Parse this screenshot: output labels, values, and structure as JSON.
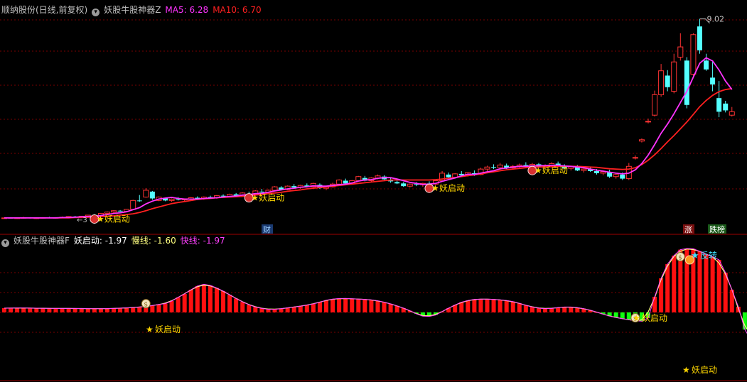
{
  "main_panel": {
    "title": "顺纳股份(日线,前复权)",
    "indicator_name": "妖股牛股神器Z",
    "ma5_label": "MA5: 6.28",
    "ma10_label": "MA10: 6.70",
    "high_label": "9.02",
    "signal_label": "妖启动",
    "cai_badge": "财",
    "zhang_badge": "涨",
    "diebang_badge": "跌榜",
    "colors": {
      "up": "#ff3333",
      "down": "#54ffff",
      "ma5": "#ff33ff",
      "ma10": "#ff2020",
      "title": "#c0c0c0",
      "grid": "#7a0000"
    }
  },
  "sub_panel": {
    "indicator_name": "妖股牛股神器F",
    "qidong_label": "妖启动: -1.97",
    "slow_label": "慢线: -1.60",
    "fast_label": "快线: -1.97",
    "signal_label": "妖启动",
    "reversal_label": "反转",
    "colors": {
      "pos": "#ff1010",
      "neg": "#10ff10",
      "slow": "#ffff80",
      "fast": "#ff40ff"
    }
  },
  "chart_data": [
    {
      "type": "candlestick",
      "title": "顺纳股份(日线,前复权)",
      "series": [
        {
          "name": "MA5",
          "color": "#ff33ff"
        },
        {
          "name": "MA10",
          "color": "#ff2020"
        }
      ],
      "max_price_label": 9.02,
      "ohlc": [
        [
          3.18,
          3.2,
          3.16,
          3.19
        ],
        [
          3.19,
          3.21,
          3.17,
          3.18
        ],
        [
          3.18,
          3.2,
          3.16,
          3.19
        ],
        [
          3.19,
          3.22,
          3.17,
          3.2
        ],
        [
          3.2,
          3.21,
          3.17,
          3.18
        ],
        [
          3.18,
          3.2,
          3.16,
          3.19
        ],
        [
          3.19,
          3.21,
          3.17,
          3.2
        ],
        [
          3.2,
          3.22,
          3.18,
          3.19
        ],
        [
          3.19,
          3.21,
          3.17,
          3.2
        ],
        [
          3.2,
          3.23,
          3.18,
          3.21
        ],
        [
          3.21,
          3.24,
          3.19,
          3.23
        ],
        [
          3.23,
          3.25,
          3.2,
          3.22
        ],
        [
          3.22,
          3.24,
          3.19,
          3.24
        ],
        [
          3.24,
          3.28,
          3.21,
          3.27
        ],
        [
          3.27,
          3.3,
          3.24,
          3.26
        ],
        [
          3.26,
          3.33,
          3.24,
          3.32
        ],
        [
          3.32,
          3.38,
          3.3,
          3.36
        ],
        [
          3.36,
          3.42,
          3.33,
          3.4
        ],
        [
          3.4,
          3.42,
          3.37,
          3.38
        ],
        [
          3.38,
          3.45,
          3.36,
          3.44
        ],
        [
          3.44,
          3.72,
          3.43,
          3.7
        ],
        [
          3.7,
          3.86,
          3.66,
          3.68
        ],
        [
          3.8,
          4.06,
          3.78,
          4.0
        ],
        [
          3.96,
          3.98,
          3.72,
          3.76
        ],
        [
          3.7,
          3.82,
          3.68,
          3.8
        ],
        [
          3.76,
          3.78,
          3.68,
          3.7
        ],
        [
          3.7,
          3.76,
          3.66,
          3.74
        ],
        [
          3.74,
          3.8,
          3.7,
          3.72
        ],
        [
          3.72,
          3.76,
          3.68,
          3.74
        ],
        [
          3.74,
          3.8,
          3.7,
          3.78
        ],
        [
          3.78,
          3.82,
          3.74,
          3.76
        ],
        [
          3.76,
          3.82,
          3.72,
          3.8
        ],
        [
          3.8,
          3.84,
          3.76,
          3.78
        ],
        [
          3.78,
          3.86,
          3.75,
          3.84
        ],
        [
          3.84,
          3.88,
          3.8,
          3.82
        ],
        [
          3.82,
          3.9,
          3.8,
          3.88
        ],
        [
          3.88,
          3.92,
          3.82,
          3.84
        ],
        [
          3.84,
          3.94,
          3.82,
          3.92
        ],
        [
          3.9,
          3.96,
          3.86,
          3.88
        ],
        [
          3.88,
          4.0,
          3.86,
          3.98
        ],
        [
          3.96,
          4.04,
          3.92,
          3.94
        ],
        [
          3.94,
          4.02,
          3.9,
          4.0
        ],
        [
          4.0,
          4.12,
          3.98,
          4.1
        ],
        [
          4.08,
          4.12,
          4.0,
          4.02
        ],
        [
          4.02,
          4.14,
          4.0,
          4.12
        ],
        [
          4.12,
          4.18,
          4.06,
          4.08
        ],
        [
          4.08,
          4.16,
          4.04,
          4.14
        ],
        [
          4.14,
          4.2,
          4.08,
          4.1
        ],
        [
          4.1,
          4.22,
          4.08,
          4.2
        ],
        [
          4.16,
          4.2,
          4.04,
          4.06
        ],
        [
          4.06,
          4.12,
          4.0,
          4.1
        ],
        [
          4.1,
          4.22,
          4.08,
          4.18
        ],
        [
          4.18,
          4.32,
          4.16,
          4.3
        ],
        [
          4.28,
          4.34,
          4.16,
          4.2
        ],
        [
          4.2,
          4.3,
          4.16,
          4.28
        ],
        [
          4.28,
          4.42,
          4.26,
          4.4
        ],
        [
          4.36,
          4.42,
          4.26,
          4.28
        ],
        [
          4.28,
          4.38,
          4.24,
          4.36
        ],
        [
          4.36,
          4.46,
          4.32,
          4.42
        ],
        [
          4.4,
          4.44,
          4.3,
          4.32
        ],
        [
          4.3,
          4.36,
          4.22,
          4.26
        ],
        [
          4.24,
          4.28,
          4.18,
          4.2
        ],
        [
          4.2,
          4.24,
          4.1,
          4.12
        ],
        [
          4.12,
          4.2,
          4.08,
          4.18
        ],
        [
          4.18,
          4.24,
          4.12,
          4.16
        ],
        [
          4.16,
          4.22,
          4.1,
          4.2
        ],
        [
          4.2,
          4.26,
          4.14,
          4.18
        ],
        [
          4.18,
          4.3,
          4.16,
          4.28
        ],
        [
          4.28,
          4.56,
          4.26,
          4.5
        ],
        [
          4.46,
          4.52,
          4.34,
          4.38
        ],
        [
          4.38,
          4.5,
          4.34,
          4.48
        ],
        [
          4.48,
          4.56,
          4.4,
          4.44
        ],
        [
          4.44,
          4.54,
          4.4,
          4.52
        ],
        [
          4.5,
          4.58,
          4.42,
          4.46
        ],
        [
          4.46,
          4.66,
          4.44,
          4.62
        ],
        [
          4.62,
          4.72,
          4.56,
          4.68
        ],
        [
          4.68,
          4.76,
          4.62,
          4.66
        ],
        [
          4.66,
          4.8,
          4.6,
          4.74
        ],
        [
          4.72,
          4.78,
          4.62,
          4.66
        ],
        [
          4.66,
          4.74,
          4.6,
          4.7
        ],
        [
          4.7,
          4.78,
          4.66,
          4.74
        ],
        [
          4.74,
          4.82,
          4.68,
          4.72
        ],
        [
          4.72,
          4.8,
          4.66,
          4.76
        ],
        [
          4.76,
          4.8,
          4.66,
          4.68
        ],
        [
          4.68,
          4.76,
          4.62,
          4.72
        ],
        [
          4.72,
          4.82,
          4.68,
          4.78
        ],
        [
          4.78,
          4.84,
          4.7,
          4.72
        ],
        [
          4.72,
          4.76,
          4.62,
          4.64
        ],
        [
          4.64,
          4.72,
          4.58,
          4.7
        ],
        [
          4.7,
          4.74,
          4.56,
          4.58
        ],
        [
          4.58,
          4.66,
          4.52,
          4.62
        ],
        [
          4.62,
          4.68,
          4.54,
          4.56
        ],
        [
          4.56,
          4.62,
          4.46,
          4.5
        ],
        [
          4.5,
          4.58,
          4.44,
          4.54
        ],
        [
          4.54,
          4.6,
          4.36,
          4.4
        ],
        [
          4.4,
          4.5,
          4.34,
          4.46
        ],
        [
          4.46,
          4.52,
          4.3,
          4.34
        ],
        [
          4.34,
          4.8,
          4.3,
          4.7
        ],
        [
          4.94,
          5.02,
          4.9,
          4.96
        ],
        [
          5.44,
          5.52,
          5.4,
          5.48
        ],
        [
          6.0,
          6.1,
          5.96,
          6.02
        ],
        [
          6.2,
          6.92,
          6.16,
          6.8
        ],
        [
          6.8,
          7.7,
          6.74,
          7.5
        ],
        [
          7.36,
          7.52,
          6.9,
          7.02
        ],
        [
          6.9,
          8.0,
          6.84,
          7.76
        ],
        [
          7.9,
          8.6,
          7.8,
          8.2
        ],
        [
          7.8,
          7.9,
          6.4,
          6.5
        ],
        [
          7.4,
          8.6,
          7.3,
          8.56
        ],
        [
          8.8,
          9.02,
          8.0,
          8.1
        ],
        [
          7.8,
          8.0,
          7.5,
          7.54
        ],
        [
          7.3,
          7.8,
          6.9,
          7.1
        ],
        [
          6.7,
          7.2,
          6.14,
          6.3
        ],
        [
          6.54,
          6.62,
          6.28,
          6.34
        ],
        [
          6.2,
          6.44,
          6.16,
          6.3
        ]
      ],
      "ma5": [
        3.19,
        3.19,
        3.19,
        3.19,
        3.19,
        3.19,
        3.19,
        3.19,
        3.19,
        3.2,
        3.2,
        3.21,
        3.22,
        3.23,
        3.24,
        3.26,
        3.29,
        3.32,
        3.34,
        3.37,
        3.43,
        3.49,
        3.6,
        3.68,
        3.74,
        3.77,
        3.79,
        3.76,
        3.74,
        3.74,
        3.74,
        3.76,
        3.77,
        3.78,
        3.8,
        3.82,
        3.83,
        3.86,
        3.87,
        3.9,
        3.91,
        3.94,
        3.98,
        4.01,
        4.04,
        4.06,
        4.09,
        4.1,
        4.13,
        4.12,
        4.12,
        4.14,
        4.16,
        4.18,
        4.21,
        4.27,
        4.3,
        4.31,
        4.35,
        4.37,
        4.37,
        4.33,
        4.28,
        4.23,
        4.2,
        4.17,
        4.18,
        4.2,
        4.26,
        4.31,
        4.36,
        4.42,
        4.47,
        4.46,
        4.5,
        4.54,
        4.57,
        4.63,
        4.65,
        4.68,
        4.7,
        4.7,
        4.71,
        4.72,
        4.72,
        4.73,
        4.73,
        4.71,
        4.7,
        4.68,
        4.66,
        4.62,
        4.59,
        4.56,
        4.53,
        4.5,
        4.48,
        4.5,
        4.6,
        4.78,
        5.03,
        5.34,
        5.67,
        5.94,
        6.24,
        6.57,
        6.9,
        7.31,
        7.72,
        7.88,
        7.79,
        7.52,
        7.2,
        6.95
      ],
      "ma10": [
        3.19,
        3.19,
        3.19,
        3.19,
        3.19,
        3.19,
        3.19,
        3.19,
        3.19,
        3.19,
        3.19,
        3.2,
        3.2,
        3.21,
        3.21,
        3.22,
        3.24,
        3.25,
        3.27,
        3.29,
        3.31,
        3.35,
        3.4,
        3.46,
        3.51,
        3.56,
        3.61,
        3.64,
        3.67,
        3.7,
        3.73,
        3.75,
        3.76,
        3.78,
        3.79,
        3.8,
        3.81,
        3.82,
        3.84,
        3.86,
        3.88,
        3.9,
        3.92,
        3.94,
        3.97,
        3.99,
        4.01,
        4.04,
        4.06,
        4.08,
        4.1,
        4.12,
        4.14,
        4.16,
        4.18,
        4.2,
        4.22,
        4.24,
        4.26,
        4.28,
        4.3,
        4.3,
        4.3,
        4.3,
        4.3,
        4.3,
        4.3,
        4.31,
        4.33,
        4.35,
        4.37,
        4.4,
        4.43,
        4.45,
        4.48,
        4.51,
        4.54,
        4.57,
        4.6,
        4.62,
        4.64,
        4.66,
        4.67,
        4.68,
        4.69,
        4.69,
        4.7,
        4.7,
        4.7,
        4.7,
        4.69,
        4.68,
        4.67,
        4.65,
        4.63,
        4.62,
        4.61,
        4.62,
        4.66,
        4.75,
        4.88,
        5.04,
        5.22,
        5.42,
        5.6,
        5.8,
        6.0,
        6.22,
        6.45,
        6.63,
        6.78,
        6.89,
        6.95,
        6.98
      ]
    },
    {
      "type": "bar",
      "title": "妖股牛股神器F",
      "series": [
        {
          "name": "妖启动",
          "values": [
            0.3,
            0.3,
            0.31,
            0.31,
            0.3,
            0.3,
            0.29,
            0.29,
            0.28,
            0.28,
            0.28,
            0.28,
            0.27,
            0.27,
            0.26,
            0.26,
            0.27,
            0.28,
            0.3,
            0.32,
            0.34,
            0.38,
            0.42,
            0.48,
            0.56,
            0.62,
            0.8,
            1.06,
            1.3,
            1.6,
            1.86,
            1.98,
            1.9,
            1.72,
            1.5,
            1.24,
            0.98,
            0.74,
            0.54,
            0.38,
            0.28,
            0.22,
            0.22,
            0.26,
            0.32,
            0.38,
            0.44,
            0.52,
            0.6,
            0.72,
            0.86,
            0.94,
            0.98,
            0.98,
            0.96,
            0.94,
            0.92,
            0.88,
            0.82,
            0.72,
            0.6,
            0.46,
            0.3,
            0.12,
            -0.1,
            -0.26,
            -0.28,
            -0.18,
            0.06,
            0.3,
            0.52,
            0.72,
            0.84,
            0.92,
            0.94,
            0.94,
            0.92,
            0.88,
            0.84,
            0.76,
            0.64,
            0.5,
            0.38,
            0.3,
            0.26,
            0.28,
            0.34,
            0.38,
            0.38,
            0.34,
            0.26,
            0.16,
            0.02,
            -0.12,
            -0.26,
            -0.36,
            -0.44,
            -0.52,
            -0.58,
            -0.62,
            -0.38,
            1.1,
            2.4,
            3.4,
            4.0,
            4.42,
            4.5,
            4.48,
            4.3,
            4.1,
            3.92,
            3.7,
            2.8,
            1.6,
            0.4,
            -1.2,
            -1.97
          ]
        },
        {
          "name": "慢线",
          "values": [
            -1.6
          ]
        },
        {
          "name": "快线",
          "values": [
            -1.97
          ]
        }
      ]
    }
  ]
}
